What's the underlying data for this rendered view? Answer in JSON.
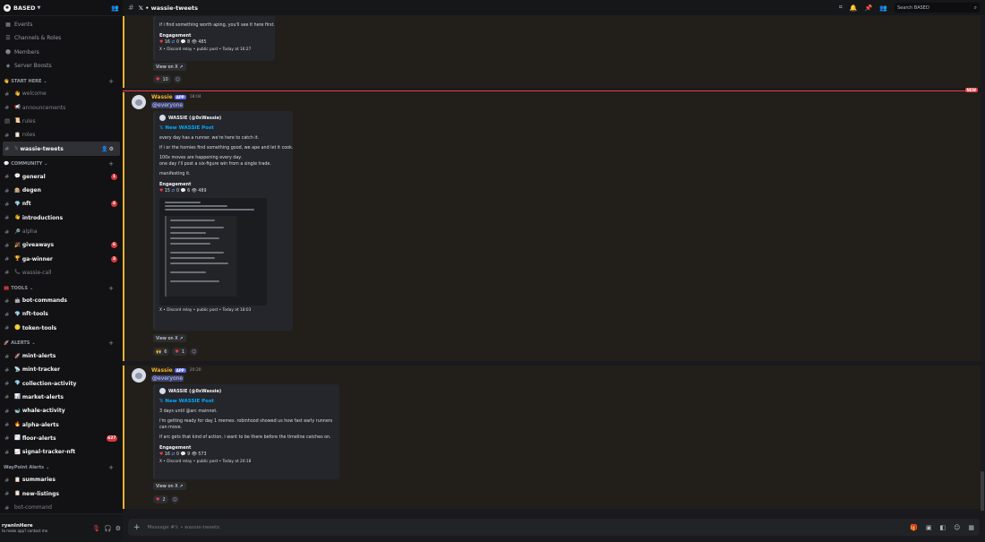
{
  "server": {
    "name": "BASED",
    "logo_char": "✺"
  },
  "nav": [
    {
      "label": "Events",
      "icon": "calendar-icon",
      "glyph": "▦"
    },
    {
      "label": "Channels & Roles",
      "icon": "channels-icon",
      "glyph": "☰"
    },
    {
      "label": "Members",
      "icon": "members-icon",
      "glyph": "☻"
    },
    {
      "label": "Server Boosts",
      "icon": "boost-icon",
      "glyph": "◈"
    }
  ],
  "categories": {
    "start": {
      "label": "START HERE",
      "emoji": "👋"
    },
    "community": {
      "label": "COMMUNITY",
      "emoji": "💬"
    },
    "tools": {
      "label": "TOOLS",
      "emoji": "🧰"
    },
    "alerts": {
      "label": "ALERTS",
      "emoji": "🚀"
    },
    "waypoint": {
      "label": "WayPoint Alerts"
    }
  },
  "channels": {
    "start": [
      {
        "name": "welcome",
        "emoji": "👋"
      },
      {
        "name": "announcements",
        "emoji": "📢"
      },
      {
        "name": "rules",
        "emoji": "📜"
      },
      {
        "name": "roles",
        "emoji": "📋"
      },
      {
        "name": "wassie-tweets",
        "emoji": "𝕏"
      }
    ],
    "community": [
      {
        "name": "general",
        "emoji": "💬",
        "badge": "1"
      },
      {
        "name": "degen",
        "emoji": "🎰"
      },
      {
        "name": "nft",
        "emoji": "💎",
        "badge": "4"
      },
      {
        "name": "introductions",
        "emoji": "👋"
      },
      {
        "name": "alpha",
        "emoji": "🔎"
      },
      {
        "name": "giveaways",
        "emoji": "🎉",
        "badge": "6"
      },
      {
        "name": "ga-winner",
        "emoji": "🏆",
        "badge": "3"
      },
      {
        "name": "wassie-call",
        "emoji": "📞"
      }
    ],
    "tools": [
      {
        "name": "bot-commands",
        "emoji": "🤖"
      },
      {
        "name": "nft-tools",
        "emoji": "💎"
      },
      {
        "name": "token-tools",
        "emoji": "🪙"
      }
    ],
    "alerts": [
      {
        "name": "mint-alerts",
        "emoji": "🚀"
      },
      {
        "name": "mint-tracker",
        "emoji": "📡"
      },
      {
        "name": "collection-activity",
        "emoji": "💎"
      },
      {
        "name": "market-alerts",
        "emoji": "📊"
      },
      {
        "name": "whale-activity",
        "emoji": "🐋"
      },
      {
        "name": "alpha-alerts",
        "emoji": "🔥"
      },
      {
        "name": "floor-alerts",
        "emoji": "📉",
        "badge": "627"
      },
      {
        "name": "signal-tracker-nft",
        "emoji": "📈"
      }
    ],
    "waypoint": [
      {
        "name": "summaries",
        "emoji": "📋"
      },
      {
        "name": "new-listings",
        "emoji": "📋"
      },
      {
        "name": "bot-command"
      }
    ]
  },
  "user": {
    "name": "ryanInHere",
    "status": "to make app? contact me"
  },
  "header": {
    "title": "𝕏 • wassie-tweets",
    "search_placeholder": "Search BASED"
  },
  "messages": {
    "top": {
      "text": "if i find something worth aping, you'll see it here first.",
      "field": "Engagement",
      "stats": {
        "likes": "16",
        "rt": "0",
        "replies": "8",
        "views": "485"
      },
      "footer": "X • Discord relay • public post • Today at 16:27",
      "view": "View on X",
      "reaction_count": "10"
    },
    "m1": {
      "author": "Wassie",
      "tag": "APP",
      "time": "18:04",
      "mention": "@everyone",
      "embed_author": "WASSIE (@0xWassie)",
      "embed_title": "𝕏 New WASSIE Post",
      "l1": "every day has a runner. we're here to catch it.",
      "l2": "if i or the homies find something good, we ape and let it cook.",
      "l3": "100x moves are happening every day.",
      "l4": "one day i'll post a six-figure win from a single trade.",
      "l5": "manifesting it.",
      "field": "Engagement",
      "stats": {
        "likes": "15",
        "rt": "0",
        "replies": "6",
        "views": "489"
      },
      "footer": "X • Discord relay • public post • Today at 18:03",
      "view": "View on X",
      "r1": "6",
      "r2": "1"
    },
    "m2": {
      "author": "Wassie",
      "tag": "APP",
      "time": "20:20",
      "mention": "@everyone",
      "embed_author": "WASSIE (@0xWassie)",
      "embed_title": "𝕏 New WASSIE Post",
      "l1": "3 days until @arc mainnet.",
      "l2": "i'm getting ready for day 1 memes. robinhood showed us how fast early runners",
      "l3": "can move.",
      "l4": "if arc gets that kind of action, i want to be there before the timeline catches on.",
      "field": "Engagement",
      "stats": {
        "likes": "16",
        "rt": "0",
        "replies": "9",
        "views": "573"
      },
      "footer": "X • Discord relay • public post • Today at 20:18",
      "view": "View on X",
      "r1": "2"
    }
  },
  "new_tag": "NEW",
  "composer": {
    "placeholder": "Message #𝕏 • wassie-tweets"
  }
}
